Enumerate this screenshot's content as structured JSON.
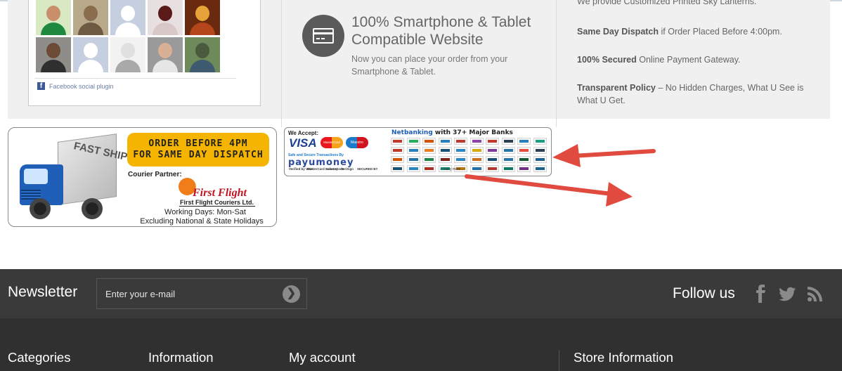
{
  "facebook": {
    "plugin_label": "Facebook social plugin",
    "faces": [
      {
        "head": "#c98f6a",
        "body": "#1f8a3f",
        "bg": "#d9e9c3"
      },
      {
        "head": "#8a6d4e",
        "body": "#6e5a43",
        "bg": "#b7a98a"
      },
      {
        "head": "#ffffff",
        "body": "#ffffff",
        "bg": "#c6cfdf"
      },
      {
        "head": "#5a1a1a",
        "body": "#d8c8c8",
        "bg": "#e8e0e0"
      },
      {
        "head": "#e8a23a",
        "body": "#b5451b",
        "bg": "#6a2a0f"
      },
      {
        "head": "#6b4b33",
        "body": "#2f2f2f",
        "bg": "#8e8d8a"
      },
      {
        "head": "#ffffff",
        "body": "#ffffff",
        "bg": "#c6cfdf"
      },
      {
        "head": "#e0e0e0",
        "body": "#a9a9a9",
        "bg": "#f2f2f2"
      },
      {
        "head": "#d8b095",
        "body": "#e6e6e6",
        "bg": "#9a9a9a"
      },
      {
        "head": "#4a5a3e",
        "body": "#3d5a6e",
        "bg": "#6e8a5a"
      }
    ]
  },
  "feature": {
    "title": "100% Smartphone & Tablet Compatible Website",
    "description": "Now you can place your order from your Smartphone & Tablet.",
    "icon": "credit-card-icon"
  },
  "promises": [
    {
      "bold": "",
      "text": "We provide Customized Printed Sky Lanterns."
    },
    {
      "bold": "Same Day Dispatch",
      "text": " if Order Placed Before 4:00pm."
    },
    {
      "bold": "100% Secured",
      "text": " Online Payment Gateway."
    },
    {
      "bold": "Transparent Policy",
      "text": " – No Hidden Charges, What U See is What U Get."
    }
  ],
  "shipping_banner": {
    "truck_text": "FAST SHIPPING",
    "order_line1": "ORDER BEFORE 4PM",
    "order_line2": "FOR SAME DAY DISPATCH",
    "courier_label": "Courier Partner:",
    "courier_name": "First Flight",
    "courier_full": "First Flight Couriers Ltd.",
    "working_days": "Working Days: Mon-Sat",
    "excluding": "Excluding National & State Holidays",
    "accent": "#f5b400"
  },
  "payment_banner": {
    "we_accept": "We Accept:",
    "visa": "VISA",
    "mastercard": "MasterCard",
    "maestro": "Maestro",
    "safe_text": "Safe and Secure Transactions By",
    "payumoney": "payumoney",
    "netbanking": "Netbanking",
    "netbanking_suffix": "with 37+ Major Banks",
    "more": "+ many more...",
    "verified": [
      "Verified by VISA",
      "MasterCard SecureCode",
      "SafeKey",
      "VeriSign",
      "SECURED BY"
    ],
    "bank_colors": [
      "#c0392b",
      "#27ae60",
      "#d35400",
      "#2980b9",
      "#c0392b",
      "#8e44ad",
      "#c0392b",
      "#2c3e50",
      "#2980b9",
      "#16a085",
      "#c0392b",
      "#2980b9",
      "#e67e22",
      "#1a5276",
      "#2e86c1",
      "#d4ac0d",
      "#7d3c98",
      "#2874a6",
      "#e74c3c",
      "#2e4053",
      "#d35400",
      "#2471a3",
      "#1e8449",
      "#7b241c",
      "#2e86c1",
      "#ca6f1e",
      "#1b4f72",
      "#2874a6",
      "#145a32",
      "#1f618d",
      "#1a5276",
      "#2e86c1",
      "#a93226",
      "#148f77",
      "#b9770e",
      "#2471a3",
      "#b03a2e",
      "#117864",
      "#6c3483",
      "#1f618d"
    ]
  },
  "newsletter": {
    "title": "Newsletter",
    "placeholder": "Enter your e-mail",
    "follow_label": "Follow us",
    "social": [
      "facebook-icon",
      "twitter-icon",
      "rss-icon"
    ]
  },
  "footer": {
    "headings": [
      "Categories",
      "Information",
      "My account",
      "Store Information"
    ]
  },
  "colors": {
    "newsletter_bg": "#3a3a3a",
    "footer_bg": "#303030",
    "arrow": "#e04a3f"
  }
}
